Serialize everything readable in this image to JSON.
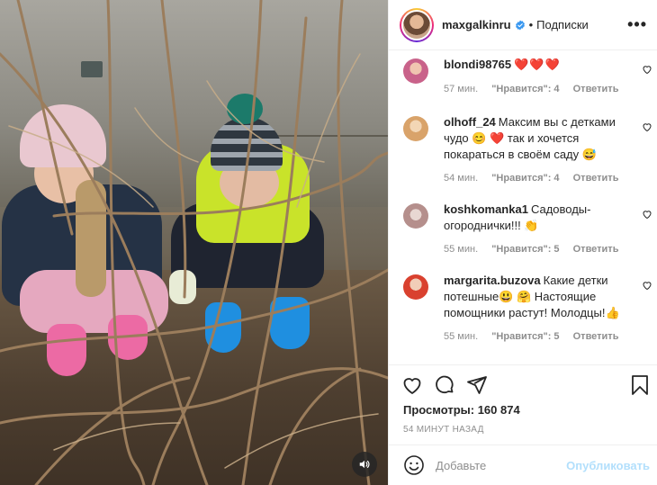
{
  "header": {
    "username": "maxgalkinru",
    "follow_label": "Подписки",
    "more_label": "•••"
  },
  "comments": [
    {
      "username": "blondi98765",
      "text": "",
      "hearts": "❤️❤️❤️",
      "time": "57 мин.",
      "likes": "\"Нравится\": 4",
      "reply": "Ответить",
      "avatar_color": "#c9628a"
    },
    {
      "username": "olhoff_24",
      "text": "Максим вы с детками чудо 😊 ❤️ так и хочется покараться в своём саду 😅",
      "hearts": "",
      "time": "54 мин.",
      "likes": "\"Нравится\": 4",
      "reply": "Ответить",
      "avatar_color": "#d9a36a"
    },
    {
      "username": "koshkomanka1",
      "text": "Садоводы-огороднички!!! 👏",
      "hearts": "",
      "time": "55 мин.",
      "likes": "\"Нравится\": 5",
      "reply": "Ответить",
      "avatar_color": "#b58f8c"
    },
    {
      "username": "margarita.buzova",
      "text": "Какие детки потешные😃 🤗 Настоящие помощники растут! Молодцы!👍",
      "hearts": "",
      "time": "55 мин.",
      "likes": "\"Нравится\": 5",
      "reply": "Ответить",
      "avatar_color": "#d9412f"
    }
  ],
  "stats": {
    "views": "Просмотры: 160 874",
    "time_ago": "54 МИНУТ НАЗАД"
  },
  "add_comment": {
    "placeholder": "Добавьте",
    "publish_label": "Опубликовать"
  },
  "colors": {
    "verified": "#3897f0",
    "publish_disabled": "#b2dffc",
    "meta_gray": "#8e8e8e"
  },
  "icons": [
    "heart-icon",
    "comment-icon",
    "share-icon",
    "bookmark-icon",
    "emoji-icon",
    "sound-icon",
    "more-icon",
    "verified-icon"
  ]
}
